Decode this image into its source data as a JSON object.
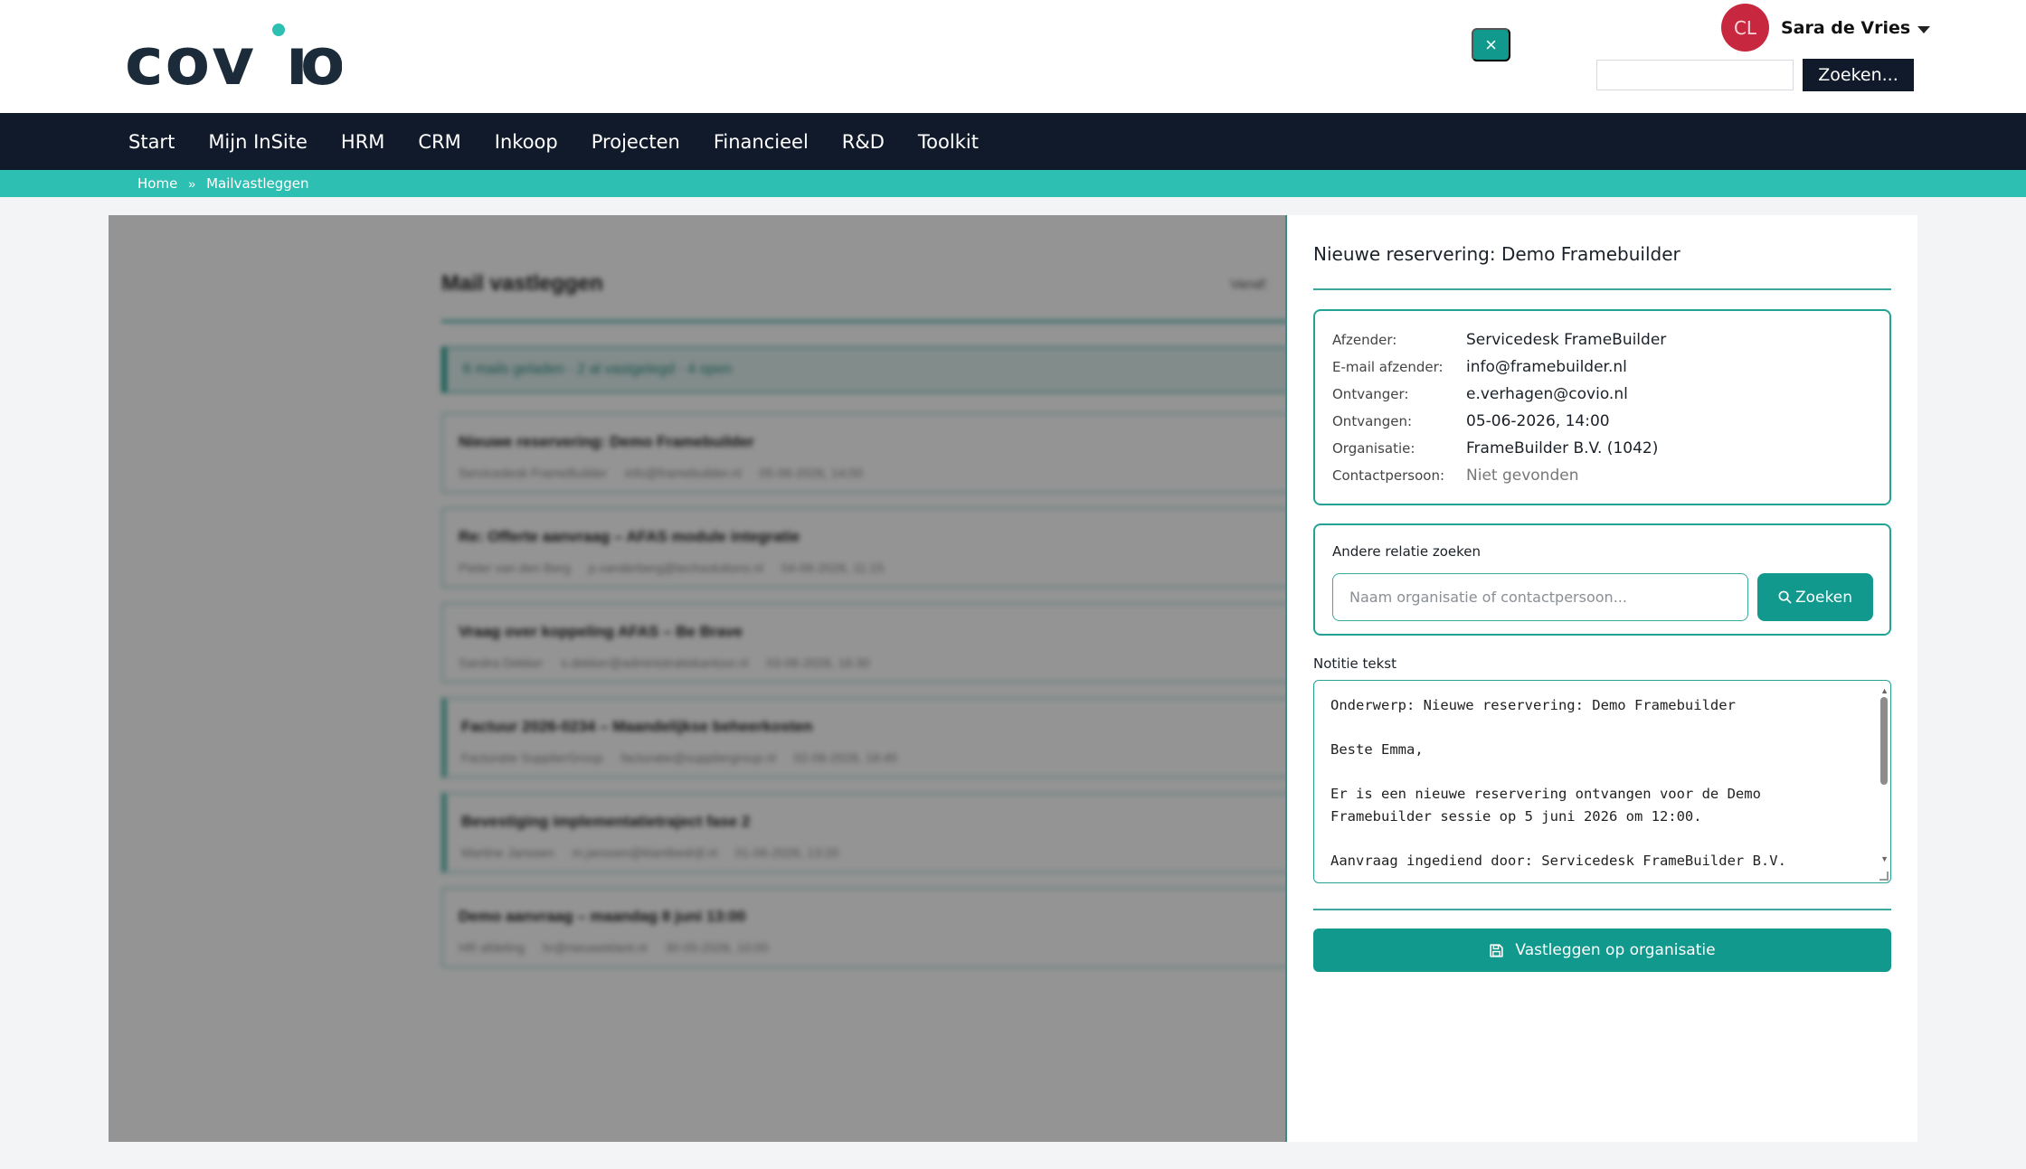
{
  "brand": {
    "logo_text": "covio",
    "accent": "#2dbfb1",
    "nav_bg": "#111a2b",
    "primary": "#10998c"
  },
  "user": {
    "initials": "CL",
    "name": "Sara de Vries"
  },
  "header": {
    "search_button": "Zoeken..."
  },
  "nav": [
    "Start",
    "Mijn InSite",
    "HRM",
    "CRM",
    "Inkoop",
    "Projecten",
    "Financieel",
    "R&D",
    "Toolkit"
  ],
  "breadcrumb": {
    "home": "Home",
    "separator": "»",
    "current": "Mailvastleggen"
  },
  "mail_list": {
    "title": "Mail vastleggen",
    "vanaf": "Vanaf:",
    "status": "6 mails geladen · 2 al vastgelegd · 4 open",
    "items": [
      {
        "subject": "Nieuwe reservering: Demo Framebuilder",
        "sender": "Servicedesk FrameBuilder",
        "email": "info@framebuilder.nl",
        "date": "05-06-2026, 14:00"
      },
      {
        "subject": "Re: Offerte aanvraag – AFAS module integratie",
        "sender": "Pieter van den Berg",
        "email": "p.vanderberg@techsolutions.nl",
        "date": "04-06-2026, 11:15"
      },
      {
        "subject": "Vraag over koppeling AFAS – Be Brave",
        "sender": "Sandra Dekker",
        "email": "s.dekker@administratiekantoor.nl",
        "date": "03-06-2026, 16:30"
      },
      {
        "subject": "Factuur 2026-0234 – Maandelijkse beheerkosten",
        "sender": "Facturatie SupplierGroup",
        "email": "facturatie@suppliergroup.nl",
        "date": "02-06-2026, 18:45"
      },
      {
        "subject": "Bevestiging implementatietraject fase 2",
        "sender": "Martine Janssen",
        "email": "m.janssen@klantbedrijf.nl",
        "date": "01-06-2026, 13:20"
      },
      {
        "subject": "Demo aanvraag – maandag 8 juni 13:00",
        "sender": "HR afdeling",
        "email": "hr@nieuweklant.nl",
        "date": "30-05-2026, 10:00"
      }
    ]
  },
  "panel": {
    "title": "Nieuwe reservering: Demo Framebuilder",
    "close": "×",
    "info": [
      {
        "label": "Afzender:",
        "value": "Servicedesk FrameBuilder"
      },
      {
        "label": "E-mail afzender:",
        "value": "info@framebuilder.nl"
      },
      {
        "label": "Ontvanger:",
        "value": "e.verhagen@covio.nl"
      },
      {
        "label": "Ontvangen:",
        "value": "05-06-2026, 14:00"
      },
      {
        "label": "Organisatie:",
        "value": "FrameBuilder B.V. (1042)"
      },
      {
        "label": "Contactpersoon:",
        "value": "Niet gevonden"
      }
    ],
    "search_label": "Andere relatie zoeken",
    "search_placeholder": "Naam organisatie of contactpersoon...",
    "search_button": "Zoeken",
    "note_label": "Notitie tekst",
    "note_text": "Onderwerp: Nieuwe reservering: Demo Framebuilder\n\nBeste Emma,\n\nEr is een nieuwe reservering ontvangen voor de Demo\nFramebuilder sessie op 5 juni 2026 om 12:00.\n\nAanvraag ingediend door: Servicedesk FrameBuilder B.V.",
    "save_button": "Vastleggen op organisatie"
  }
}
